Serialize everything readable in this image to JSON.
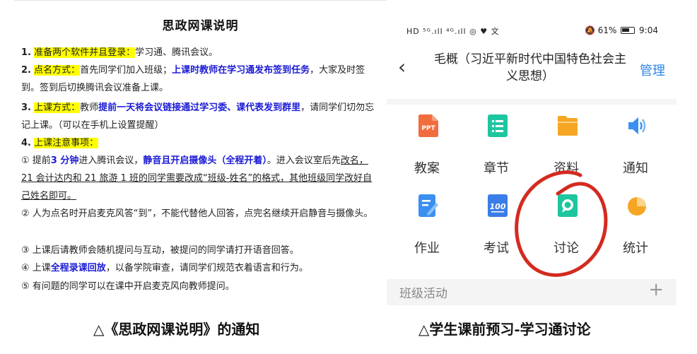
{
  "document": {
    "title": "思政网课说明",
    "items": {
      "i1_num": "1.",
      "i1_hl": "准备两个软件并且登录：",
      "i1_text": "学习通、腾讯会议。",
      "i2_num": "2.",
      "i2_hl": "点名方式：",
      "i2_a": "首先同学们加入班级；",
      "i2_b": "上课时教师在学习通发布签到任务",
      "i2_c": "，大家及时签到。签到后切换腾讯会议准备上课。",
      "i3_num": "3.",
      "i3_hl": "上课方式：",
      "i3_a": "教师",
      "i3_b": "提前一天将会议链接通过学习委、课代表发到群里",
      "i3_c": "，请同学们切勿忘记上课。（可以在手机上设置提醒）",
      "i4_num": "4.",
      "i4_hl": "上课注意事项：",
      "n1_a": "① 提前",
      "n1_b": "3 分钟",
      "n1_c": "进入腾讯会议，",
      "n1_d": "静音且开启摄像头（全程开着）",
      "n1_e": "。进入会议室后先",
      "n1_f": "改名，21 会计达内和 21 旅游 1 班的同学需要改成“班级-姓名”的格式，其他班级同学改好自己姓名即可。",
      "n2": "② 人为点名时开启麦克风答“到”，不能代替他人回答，点完名继续开启静音与摄像头。",
      "n3": "③ 上课后请教师会随机提问与互动，被提问的同学请打开语音回答。",
      "n4_a": "④ 上课",
      "n4_b": "全程录课回放",
      "n4_c": "，以备学院审查，请同学们规范衣着语言和行为。",
      "n5": "⑤ 有问题的同学可以在课中开启麦克风向教师提问。"
    }
  },
  "phone": {
    "status_left": "HD ⁵ᴳ.ıll ⁴ᴳ.ıll ◎ ♥ 文",
    "status_mute": "🔕",
    "status_battery": "61%",
    "status_time": "9:04",
    "back_label": "‹",
    "course_title": "毛概（习近平新时代中国特色社会主义思想）",
    "manage_label": "管理",
    "grid": [
      {
        "label": "教案",
        "icon": "ppt-icon",
        "color": "#f26d3d"
      },
      {
        "label": "章节",
        "icon": "chapter-list-icon",
        "color": "#1ec6a0"
      },
      {
        "label": "资料",
        "icon": "folder-icon",
        "color": "#f6a623"
      },
      {
        "label": "通知",
        "icon": "speaker-icon",
        "color": "#3b8ff0"
      },
      {
        "label": "作业",
        "icon": "homework-icon",
        "color": "#3b8ff0"
      },
      {
        "label": "考试",
        "icon": "exam-100-icon",
        "color": "#3b7de8"
      },
      {
        "label": "讨论",
        "icon": "discussion-bubble-icon",
        "color": "#1ec6a0"
      },
      {
        "label": "统计",
        "icon": "pie-chart-icon",
        "color": "#f6a623"
      }
    ],
    "section_label": "班级活动",
    "section_plus": "+",
    "annotation_color": "#d42a1f"
  },
  "captions": {
    "left": "△《思政网课说明》的通知",
    "right": "△学生课前预习-学习通讨论"
  }
}
